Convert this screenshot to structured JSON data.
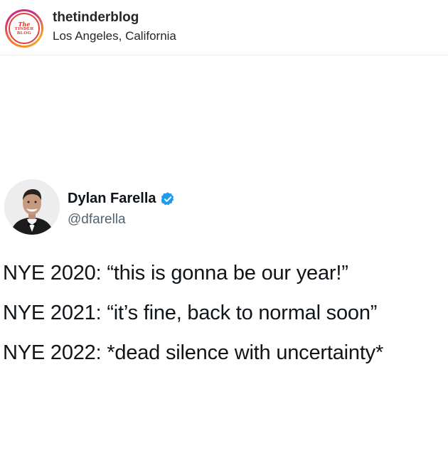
{
  "post": {
    "account_name": "thetinderblog",
    "location": "Los Angeles, California",
    "logo_text": {
      "top": "The",
      "middle": "TINDER",
      "bottom": "BLOG"
    }
  },
  "tweet": {
    "display_name": "Dylan Farella",
    "handle": "@dfarella",
    "verified": true,
    "lines": [
      "NYE 2020: “this is gonna be our year!”",
      "NYE 2021: “it’s fine, back to normal soon”",
      "NYE 2022: *dead silence with uncertainty*"
    ]
  },
  "colors": {
    "verified_blue": "#1d9bf0",
    "logo_red": "#d9322a",
    "handle_gray": "#536471"
  },
  "icons": {
    "verified": "verified-badge-icon",
    "profile": "profile-photo-icon"
  }
}
